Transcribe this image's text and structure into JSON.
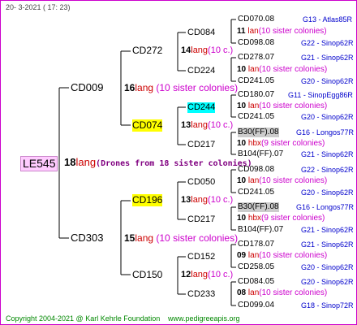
{
  "header": {
    "date": "20-  3-2021 (  17:  23)"
  },
  "footer": {
    "copyright": "Copyright 2004-2021 @ Karl Kehrle Foundation",
    "website": "www.pedigreeapis.org"
  },
  "root": {
    "label": "LE545",
    "count": "18",
    "lang": "lang",
    "note": "(Drones from 18 sister colonies)"
  },
  "gen1": [
    {
      "label": "CD009",
      "count": "16",
      "lang": "lang",
      "note": "(10 sister colonies)"
    },
    {
      "label": "CD303",
      "count": "15",
      "lang": "lang",
      "note": "(10 sister colonies)"
    }
  ],
  "gen2": [
    {
      "label": "CD272",
      "count": "14",
      "lang": "lang",
      "note": "(10 c.)"
    },
    {
      "label": "CD074",
      "count": "13",
      "lang": "lang",
      "note": "(10 c.)"
    },
    {
      "label": "CD196",
      "count": "13",
      "lang": "lang",
      "note": "(10 c.)"
    },
    {
      "label": "CD150",
      "count": "12",
      "lang": "lang",
      "note": "(10 c.)"
    }
  ],
  "gen3": [
    {
      "label": "CD084"
    },
    {
      "label": "CD224"
    },
    {
      "label": "CD244"
    },
    {
      "label": "CD217"
    },
    {
      "label": "CD050"
    },
    {
      "label": "CD217"
    },
    {
      "label": "CD152"
    },
    {
      "label": "CD233"
    }
  ],
  "gen4": [
    {
      "label": "CD070.08",
      "tag": "G13 - Atlas85R"
    },
    {
      "label": "CD098.08",
      "tag": "G22 - Sinop62R"
    },
    {
      "label": "CD278.07",
      "tag": "G21 - Sinop62R"
    },
    {
      "label": "CD241.05",
      "tag": "G20 - Sinop62R"
    },
    {
      "label": "CD180.07",
      "tag": "G11 - SinopEgg86R"
    },
    {
      "label": "CD241.05",
      "tag": "G20 - Sinop62R"
    },
    {
      "label": "B30(FF).08",
      "tag": "G16 - Longos77R"
    },
    {
      "label": "B104(FF).07",
      "tag": "G21 - Sinop62R"
    },
    {
      "label": "CD098.08",
      "tag": "G22 - Sinop62R"
    },
    {
      "label": "CD241.05",
      "tag": "G20 - Sinop62R"
    },
    {
      "label": "B30(FF).08",
      "tag": "G16 - Longos77R"
    },
    {
      "label": "B104(FF).07",
      "tag": "G21 - Sinop62R"
    },
    {
      "label": "CD178.07",
      "tag": "G21 - Sinop62R"
    },
    {
      "label": "CD258.05",
      "tag": "G20 - Sinop62R"
    },
    {
      "label": "CD084.05",
      "tag": "G20 - Sinop62R"
    },
    {
      "label": "CD099.04",
      "tag": "G18 - Sinop72R"
    }
  ],
  "gen3_notes": [
    {
      "count": "11",
      "kind": "lan",
      "note": "(10 sister colonies)"
    },
    {
      "count": "10",
      "kind": "lan",
      "note": "(10 sister colonies)"
    },
    {
      "count": "10",
      "kind": "lan",
      "note": "(10 sister colonies)"
    },
    {
      "count": "10",
      "kind": "hbx",
      "note": "(9 sister colonies)"
    },
    {
      "count": "10",
      "kind": "lan",
      "note": "(10 sister colonies)"
    },
    {
      "count": "10",
      "kind": "hbx",
      "note": "(9 sister colonies)"
    },
    {
      "count": "09",
      "kind": "lan",
      "note": "(10 sister colonies)"
    },
    {
      "count": "08",
      "kind": "lan",
      "note": "(10 sister colonies)"
    }
  ]
}
